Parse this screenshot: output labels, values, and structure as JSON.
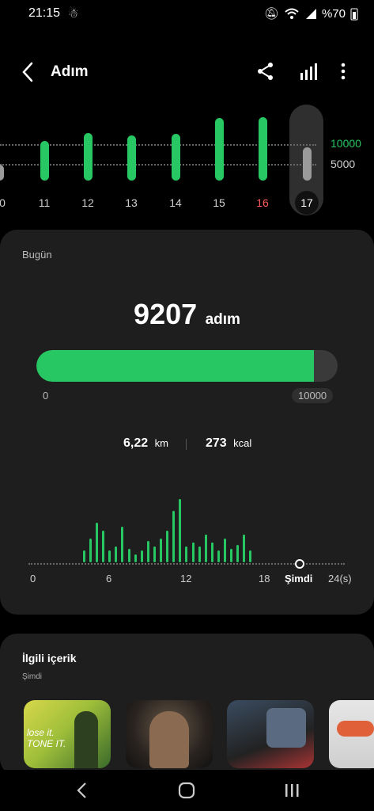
{
  "status_bar": {
    "time": "21:15",
    "battery": "%70"
  },
  "header": {
    "title": "Adım"
  },
  "weekly_chart": {
    "labels": [
      "0",
      "11",
      "12",
      "13",
      "14",
      "15",
      "16",
      "17"
    ],
    "highlight_label": "16",
    "selected_label": "17",
    "values": [
      3500,
      8800,
      10500,
      9900,
      10300,
      13800,
      14000,
      9207
    ],
    "goal_label": "10000",
    "mid_label": "5000"
  },
  "today": {
    "section_label": "Bugün",
    "steps": "9207",
    "steps_unit": "adım",
    "goal": 10000,
    "progress_fraction": 0.9207,
    "min_label": "0",
    "max_label": "10000",
    "distance": "6,22",
    "distance_unit": "km",
    "calories": "273",
    "calories_unit": "kcal"
  },
  "hourly_chart": {
    "type": "bar",
    "x_tick_labels": [
      "0",
      "6",
      "12",
      "18",
      "Şimdi",
      "24(s)"
    ],
    "values": [
      0,
      0,
      0,
      0,
      0,
      0,
      0,
      0,
      0.3,
      0.6,
      1.0,
      0.8,
      0.3,
      0.4,
      0.9,
      0.35,
      0.2,
      0.3,
      0.55,
      0.4,
      0.6,
      0.8,
      1.3,
      1.6,
      0.4,
      0.5,
      0.4,
      0.7,
      0.5,
      0.3,
      0.6,
      0.35,
      0.45,
      0.7,
      0.3
    ]
  },
  "related": {
    "title": "İlgili içerik",
    "subtitle": "Şimdi",
    "thumb1_text": "lose it. TONE IT."
  }
}
